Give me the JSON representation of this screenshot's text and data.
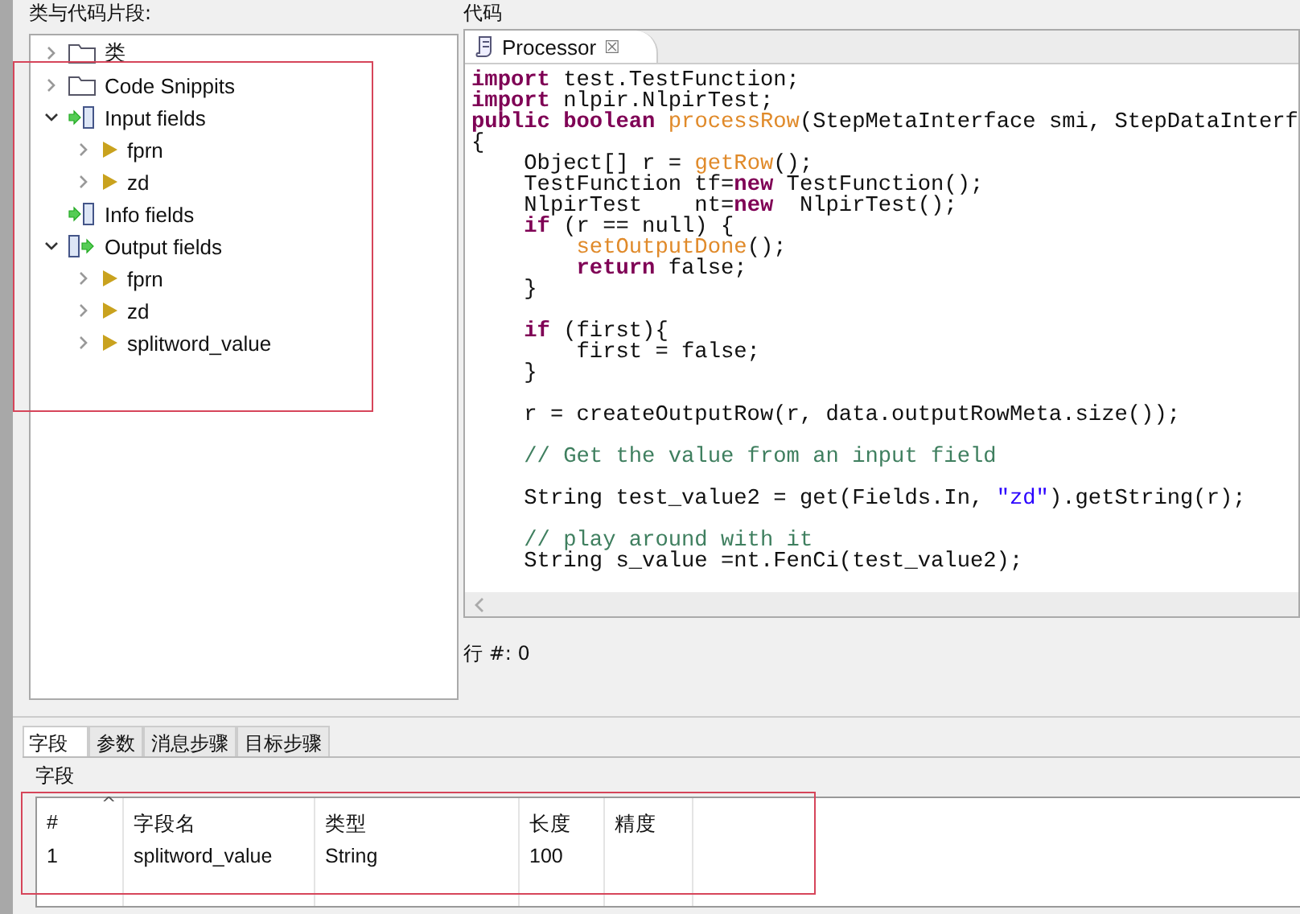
{
  "left_panel": {
    "title": "类与代码片段:",
    "tree": [
      {
        "label": "类",
        "kind": "folder",
        "expanded": false
      },
      {
        "label": "Code Snippits",
        "kind": "folder",
        "expanded": false
      },
      {
        "label": "Input fields",
        "kind": "input",
        "expanded": true,
        "children": [
          {
            "label": "fprn",
            "kind": "field",
            "expanded": false
          },
          {
            "label": "zd",
            "kind": "field",
            "expanded": false
          }
        ]
      },
      {
        "label": "Info fields",
        "kind": "input"
      },
      {
        "label": "Output fields",
        "kind": "output",
        "expanded": true,
        "children": [
          {
            "label": "fprn",
            "kind": "field",
            "expanded": false
          },
          {
            "label": "zd",
            "kind": "field",
            "expanded": false
          },
          {
            "label": "splitword_value",
            "kind": "field",
            "expanded": false
          }
        ]
      }
    ]
  },
  "code_panel": {
    "title": "代码",
    "tabs": [
      {
        "label": "Processor",
        "close": "☒",
        "selected": true
      }
    ],
    "lines": [
      {
        "kind": "code",
        "tokens": [
          {
            "kind": "keyword",
            "text": "import"
          },
          {
            "kind": "plain",
            "text": " test.TestFunction;"
          }
        ]
      },
      {
        "kind": "code",
        "tokens": [
          {
            "kind": "keyword",
            "text": "import"
          },
          {
            "kind": "plain",
            "text": " nlpir.NlpirTest;"
          }
        ]
      },
      {
        "kind": "code",
        "tokens": [
          {
            "kind": "keyword",
            "text": "public boolean "
          },
          {
            "kind": "method",
            "text": "processRow"
          },
          {
            "kind": "plain",
            "text": "(StepMetaInterface smi, StepDataInterf"
          }
        ]
      },
      {
        "kind": "code",
        "tokens": [
          {
            "kind": "plain",
            "text": "{"
          }
        ]
      },
      {
        "kind": "code",
        "tokens": [
          {
            "kind": "plain",
            "text": "    Object[] r = "
          },
          {
            "kind": "method",
            "text": "getRow"
          },
          {
            "kind": "plain",
            "text": "();"
          }
        ]
      },
      {
        "kind": "code",
        "tokens": [
          {
            "kind": "plain",
            "text": "    TestFunction tf="
          },
          {
            "kind": "keyword",
            "text": "new"
          },
          {
            "kind": "plain",
            "text": " TestFunction();"
          }
        ]
      },
      {
        "kind": "code",
        "tokens": [
          {
            "kind": "plain",
            "text": "    NlpirTest    nt="
          },
          {
            "kind": "keyword",
            "text": "new"
          },
          {
            "kind": "plain",
            "text": "  NlpirTest();"
          }
        ]
      },
      {
        "kind": "code",
        "tokens": [
          {
            "kind": "keyword",
            "text": "    if"
          },
          {
            "kind": "plain",
            "text": " (r == null) {"
          }
        ]
      },
      {
        "kind": "code",
        "tokens": [
          {
            "kind": "method",
            "text": "        setOutputDone"
          },
          {
            "kind": "plain",
            "text": "();"
          }
        ]
      },
      {
        "kind": "code",
        "tokens": [
          {
            "kind": "keyword",
            "text": "        return"
          },
          {
            "kind": "plain",
            "text": " false;"
          }
        ]
      },
      {
        "kind": "code",
        "tokens": [
          {
            "kind": "plain",
            "text": "    }"
          }
        ]
      },
      {
        "kind": "blank"
      },
      {
        "kind": "code",
        "tokens": [
          {
            "kind": "keyword",
            "text": "    if"
          },
          {
            "kind": "plain",
            "text": " (first){"
          }
        ]
      },
      {
        "kind": "code",
        "tokens": [
          {
            "kind": "plain",
            "text": "        first = false;"
          }
        ]
      },
      {
        "kind": "code",
        "tokens": [
          {
            "kind": "plain",
            "text": "    }"
          }
        ]
      },
      {
        "kind": "blank"
      },
      {
        "kind": "code",
        "tokens": [
          {
            "kind": "plain",
            "text": "    r = createOutputRow(r, data.outputRowMeta.size());"
          }
        ]
      },
      {
        "kind": "blank"
      },
      {
        "kind": "code",
        "tokens": [
          {
            "kind": "comment",
            "text": "    // Get the value from an input field"
          }
        ]
      },
      {
        "kind": "blank"
      },
      {
        "kind": "code",
        "tokens": [
          {
            "kind": "plain",
            "text": "    String test_value2 = get(Fields.In, "
          },
          {
            "kind": "string",
            "text": "\"zd\""
          },
          {
            "kind": "plain",
            "text": ").getString(r);"
          }
        ]
      },
      {
        "kind": "blank"
      },
      {
        "kind": "code",
        "tokens": [
          {
            "kind": "comment",
            "text": "    // play around with it"
          }
        ]
      },
      {
        "kind": "code",
        "tokens": [
          {
            "kind": "plain",
            "text": "    String s_value =nt.FenCi(test_value2);"
          }
        ]
      }
    ],
    "row_status": "行 #: 0"
  },
  "bottom_tabs": [
    {
      "label": "字段",
      "selected": true
    },
    {
      "label": "参数",
      "selected": false
    },
    {
      "label": "消息步骤",
      "selected": false
    },
    {
      "label": "目标步骤",
      "selected": false
    }
  ],
  "fields_group": {
    "title": "字段",
    "sort_indicator": "^",
    "columns": [
      "#",
      "字段名",
      "类型",
      "长度",
      "精度"
    ],
    "rows": [
      [
        "1",
        "splitword_value",
        "String",
        "100",
        null
      ]
    ]
  }
}
